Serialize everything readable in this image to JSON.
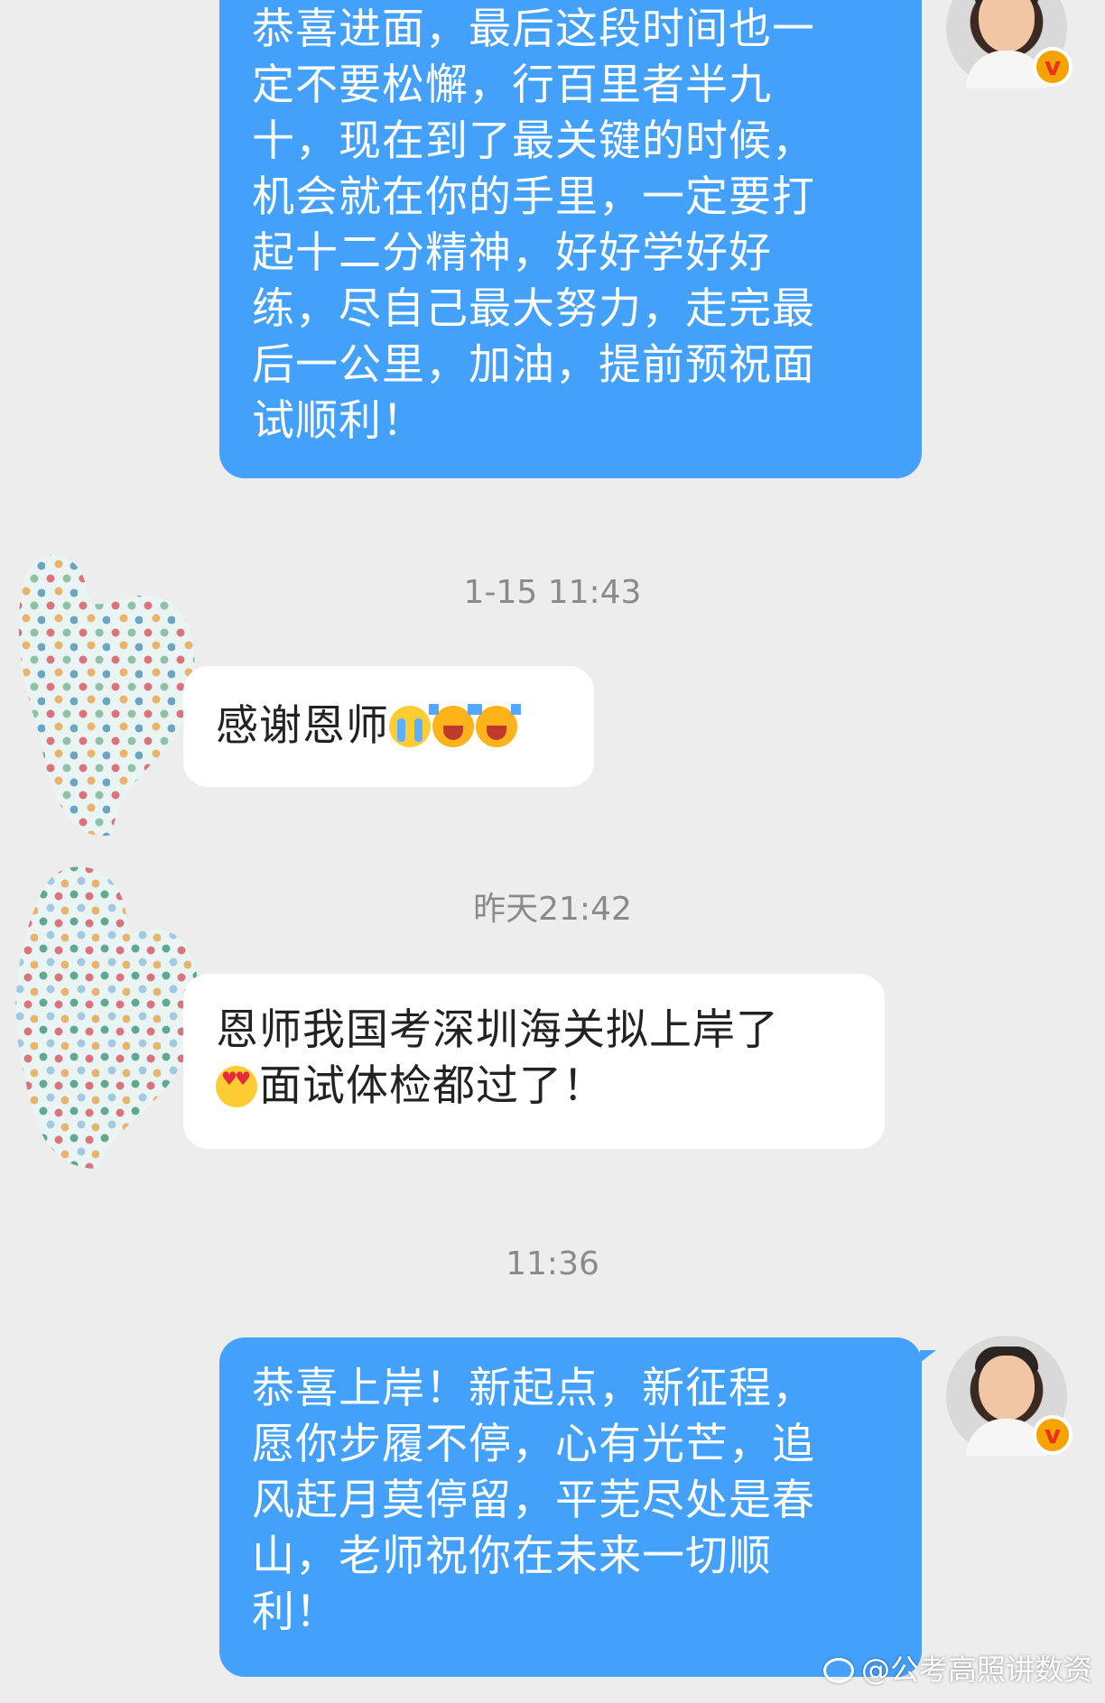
{
  "messages": [
    {
      "sender": "teacher",
      "lines": [
        "恭喜进面，最后这段时间也一",
        "定不要松懈，行百里者半九",
        "十，现在到了最关键的时候，",
        "机会就在你的手里，一定要打",
        "起十二分精神，好好学好好",
        "练，尽自己最大努力，走完最",
        "后一公里，加油，提前预祝面",
        "试顺利！"
      ]
    },
    {
      "timestamp": "1-15 11:43"
    },
    {
      "sender": "student",
      "text": "感谢恩师",
      "emojis": [
        "loudly-crying-face",
        "laughing-face",
        "laughing-face"
      ]
    },
    {
      "timestamp": "昨天21:42"
    },
    {
      "sender": "student",
      "line1": "恩师我国考深圳海关拟上岸了",
      "line2": "面试体检都过了！",
      "emojis": [
        "heart-eyes-face"
      ]
    },
    {
      "timestamp": "11:36"
    },
    {
      "sender": "teacher",
      "lines": [
        "恭喜上岸！新起点，新征程，",
        "愿你步履不停，心有光芒，追",
        "风赶月莫停留，平芜尽处是春",
        "山，老师祝你在未来一切顺",
        "利！"
      ]
    }
  ],
  "verified_badge": "v",
  "watermark": "@公考高照讲数资",
  "colors": {
    "outgoing_bubble": "#44a1fb",
    "incoming_bubble": "#ffffff",
    "background": "#ededed",
    "timestamp": "#8a8a8a"
  }
}
